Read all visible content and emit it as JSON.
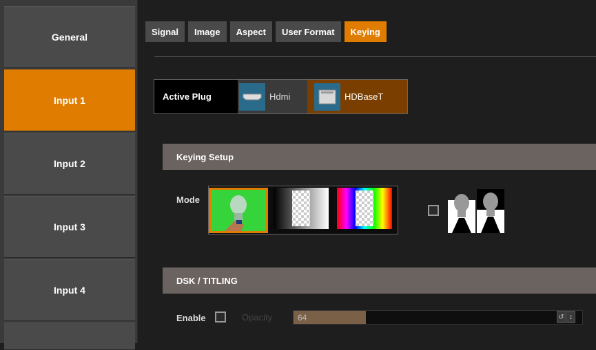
{
  "sidebar": {
    "items": [
      {
        "label": "General",
        "active": false
      },
      {
        "label": "Input 1",
        "active": true
      },
      {
        "label": "Input 2",
        "active": false
      },
      {
        "label": "Input 3",
        "active": false
      },
      {
        "label": "Input 4",
        "active": false
      }
    ]
  },
  "tabs": [
    {
      "label": "Signal",
      "active": false
    },
    {
      "label": "Image",
      "active": false
    },
    {
      "label": "Aspect",
      "active": false
    },
    {
      "label": "User Format",
      "active": false
    },
    {
      "label": "Keying",
      "active": true
    }
  ],
  "active_plug": {
    "label": "Active Plug",
    "options": [
      {
        "label": "Hdmi",
        "icon": "hdmi-port-icon",
        "selected": false
      },
      {
        "label": "HDBaseT",
        "icon": "rj45-port-icon",
        "selected": true
      }
    ]
  },
  "keying_setup": {
    "title": "Keying Setup",
    "mode_label": "Mode",
    "modes": [
      {
        "icon": "chroma-key-icon",
        "selected": true
      },
      {
        "icon": "luma-key-icon",
        "selected": false
      },
      {
        "icon": "color-key-icon",
        "selected": false
      }
    ],
    "invert_checked": false,
    "invert_icon": "invert-key-icon"
  },
  "dsk": {
    "title": "DSK / TITLING",
    "enable_label": "Enable",
    "enable_checked": false,
    "opacity_label": "Opacity",
    "opacity_value": "64",
    "opacity_fraction": 0.25
  },
  "colors": {
    "accent": "#e07d00",
    "sidebar_item": "#4a4a4a",
    "section_bar": "#6b6360"
  }
}
